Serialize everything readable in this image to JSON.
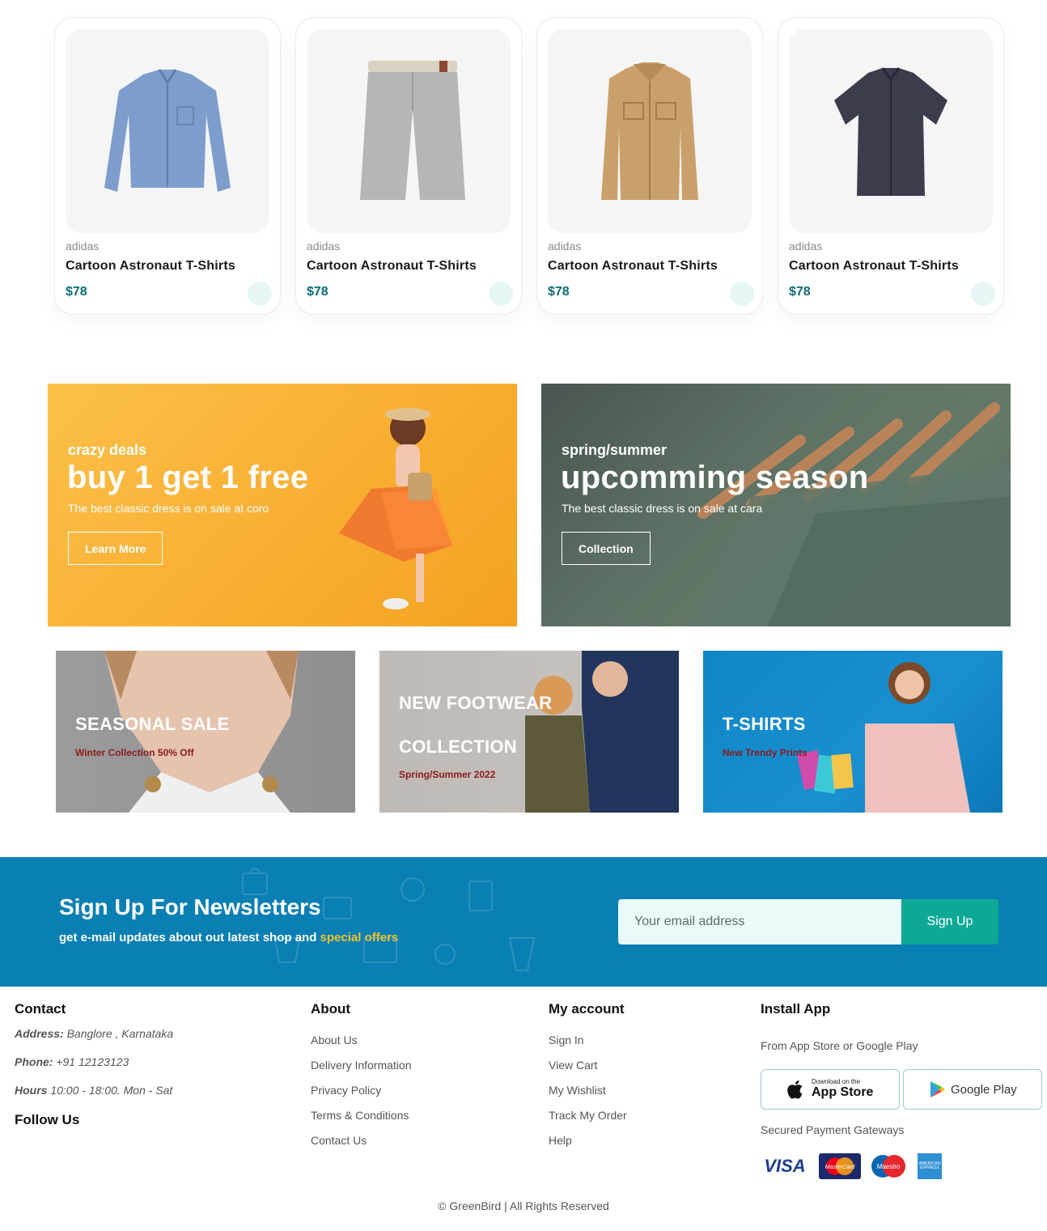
{
  "products": [
    {
      "brand": "adidas",
      "name": "Cartoon Astronaut T-Shirts",
      "price": "$78",
      "image": "blue-shirt"
    },
    {
      "brand": "adidas",
      "name": "Cartoon Astronaut T-Shirts",
      "price": "$78",
      "image": "grey-shorts"
    },
    {
      "brand": "adidas",
      "name": "Cartoon Astronaut T-Shirts",
      "price": "$78",
      "image": "tan-jacket"
    },
    {
      "brand": "adidas",
      "name": "Cartoon Astronaut T-Shirts",
      "price": "$78",
      "image": "navy-shirt"
    }
  ],
  "banners": {
    "deal": {
      "kicker": "crazy deals",
      "headline": "buy 1 get 1 free",
      "desc": "The best classic dress is on sale at coro",
      "button": "Learn More"
    },
    "season": {
      "kicker": "spring/summer",
      "headline": "upcomming season",
      "desc": "The best classic dress is on sale at cara",
      "button": "Collection"
    }
  },
  "tiles": {
    "seasonal": {
      "title": "SEASONAL SALE",
      "sub": "Winter Collection 50% Off"
    },
    "footwear": {
      "title1": "NEW FOOTWEAR",
      "title2": "COLLECTION",
      "sub": "Spring/Summer 2022"
    },
    "tshirts": {
      "title": "T-SHIRTS",
      "sub": "New Trendy Prints"
    }
  },
  "newsletter": {
    "title": "Sign Up For Newsletters",
    "sub_prefix": "get e-mail updates about out latest shop and",
    "sub_highlight": "special offers",
    "placeholder": "Your email address",
    "button": "Sign Up"
  },
  "footer": {
    "contact": {
      "heading": "Contact",
      "address_label": "Address:",
      "address": "Banglore , Karnataka",
      "phone_label": "Phone:",
      "phone": "+91 12123123",
      "hours_label": "Hours",
      "hours": "10:00 - 18:00. Mon - Sat",
      "follow": "Follow Us"
    },
    "about": {
      "heading": "About",
      "links": [
        "About Us",
        "Delivery Information",
        "Privacy Policy",
        "Terms & Conditions",
        "Contact Us"
      ]
    },
    "account": {
      "heading": "My account",
      "links": [
        "Sign In",
        "View Cart",
        "My Wishlist",
        "Track My Order",
        "Help"
      ]
    },
    "app": {
      "heading": "Install App",
      "sub": "From App Store or Google Play",
      "appstore_small": "Download on the",
      "appstore_big": "App Store",
      "googleplay": "Google Play",
      "payments_label": "Secured Payment Gateways",
      "visa": "VISA",
      "mastercard": "MasterCard",
      "maestro": "Maestro",
      "amex": "AMERICAN EXPRESS"
    },
    "copyright": "© GreenBird | All Rights Reserved"
  },
  "colors": {
    "accent": "#0b6b73",
    "newsletter_bg": "#0a7fb3",
    "signup_btn": "#0fa896",
    "highlight": "#f2c22c"
  }
}
